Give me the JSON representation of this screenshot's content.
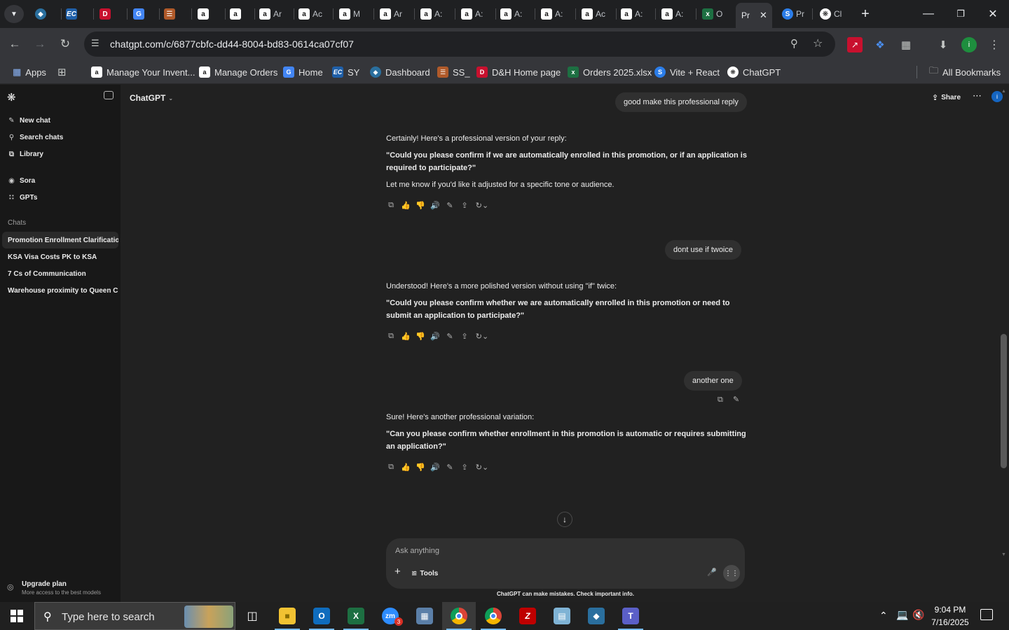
{
  "browser": {
    "tabs": [
      {
        "label": "",
        "icon": "chevron-down-icon"
      },
      {
        "label": "",
        "icon": "kite-icon"
      },
      {
        "label": "",
        "icon": "ec-icon"
      },
      {
        "label": "",
        "icon": "dh-icon"
      },
      {
        "label": "",
        "icon": "docs-icon"
      },
      {
        "label": "",
        "icon": "stack-icon"
      },
      {
        "label": "",
        "icon": "amazon-icon"
      },
      {
        "label": "",
        "icon": "amazon-icon"
      },
      {
        "label": "Ar",
        "icon": "amazon-icon"
      },
      {
        "label": "Ac",
        "icon": "amazon-icon"
      },
      {
        "label": "M",
        "icon": "amazon-icon"
      },
      {
        "label": "Ar",
        "icon": "amazon-icon"
      },
      {
        "label": "A:",
        "icon": "amazon-icon"
      },
      {
        "label": "A:",
        "icon": "amazon-icon"
      },
      {
        "label": "A:",
        "icon": "amazon-icon"
      },
      {
        "label": "A:",
        "icon": "amazon-icon"
      },
      {
        "label": "Ac",
        "icon": "amazon-icon"
      },
      {
        "label": "A:",
        "icon": "amazon-icon"
      },
      {
        "label": "A:",
        "icon": "amazon-icon"
      },
      {
        "label": "O",
        "icon": "excel-icon"
      },
      {
        "label": "Pr",
        "icon": "",
        "active": true
      },
      {
        "label": "Pr",
        "icon": "s-icon"
      },
      {
        "label": "Cl",
        "icon": "openai-icon"
      }
    ],
    "url": "chatgpt.com/c/6877cbfc-dd44-8004-bd83-0614ca07cf07",
    "bookmarks": [
      {
        "label": "Apps"
      },
      {
        "label": ""
      },
      {
        "label": "Manage Your Invent..."
      },
      {
        "label": "Manage Orders"
      },
      {
        "label": "Home"
      },
      {
        "label": "SY"
      },
      {
        "label": "Dashboard"
      },
      {
        "label": "SS_"
      },
      {
        "label": "D&H Home page"
      },
      {
        "label": "Orders 2025.xlsx"
      },
      {
        "label": "Vite + React"
      },
      {
        "label": "ChatGPT"
      }
    ],
    "all_bookmarks": "All Bookmarks",
    "profile_initial": "i"
  },
  "sidebar": {
    "top_items": [
      {
        "label": "New chat",
        "icon": "edit-icon"
      },
      {
        "label": "Search chats",
        "icon": "search-icon"
      },
      {
        "label": "Library",
        "icon": "library-icon"
      }
    ],
    "mid_items": [
      {
        "label": "Sora",
        "icon": "sora-icon"
      },
      {
        "label": "GPTs",
        "icon": "grid-icon"
      }
    ],
    "chats_heading": "Chats",
    "chats": [
      {
        "label": "Promotion Enrollment Clarification",
        "active": true
      },
      {
        "label": "KSA Visa Costs PK to KSA"
      },
      {
        "label": "7 Cs of Communication"
      },
      {
        "label": "Warehouse proximity to Queen C..."
      }
    ],
    "upgrade_title": "Upgrade plan",
    "upgrade_sub": "More access to the best models"
  },
  "header": {
    "model": "ChatGPT",
    "share": "Share",
    "avatar": "i"
  },
  "conversation": {
    "msg1_user": "good make this professional reply",
    "msg1_intro": "Certainly! Here's a professional version of your reply:",
    "msg1_quote": "\"Could you please confirm if we are automatically enrolled in this promotion, or if an application is required to participate?\"",
    "msg1_outro": "Let me know if you'd like it adjusted for a specific tone or audience.",
    "msg2_user": "dont use if twoice",
    "msg2_intro": "Understood! Here's a more polished version without using \"if\" twice:",
    "msg2_quote": "\"Could you please confirm whether we are automatically enrolled in this promotion or need to submit an application to participate?\"",
    "msg3_user": "another one",
    "msg3_intro": "Sure! Here's another professional variation:",
    "msg3_quote": "\"Can you please confirm whether enrollment in this promotion is automatic or requires submitting an application?\""
  },
  "composer": {
    "placeholder": "Ask anything",
    "tools": "Tools",
    "disclaimer": "ChatGPT can make mistakes. Check important info."
  },
  "taskbar": {
    "search_placeholder": "Type here to search",
    "time": "9:04 PM",
    "date": "7/16/2025",
    "zoom_badge": "3"
  }
}
